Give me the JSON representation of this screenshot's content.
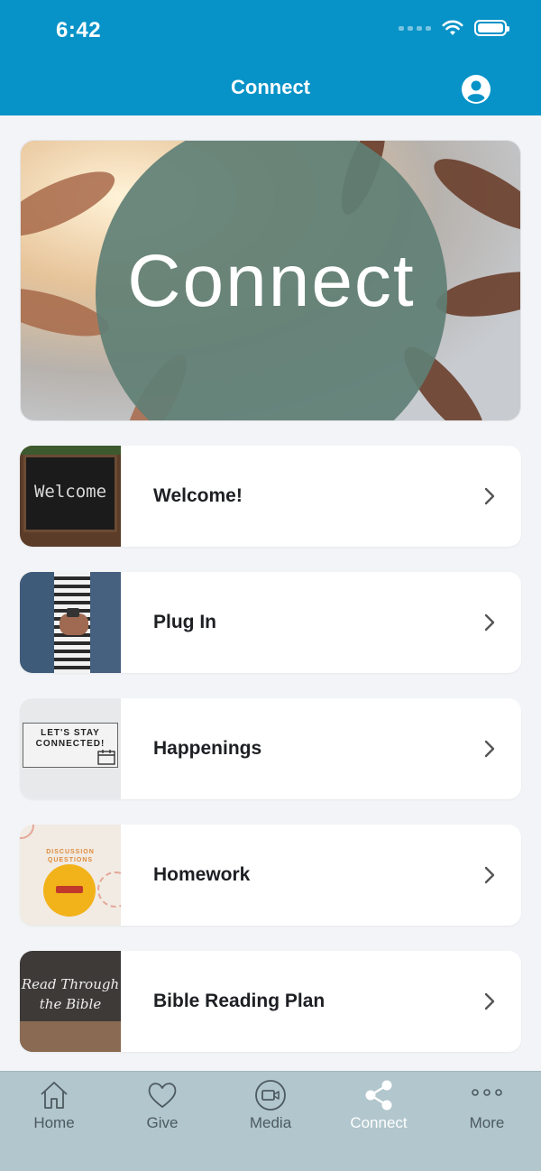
{
  "status_bar": {
    "time": "6:42"
  },
  "header": {
    "title": "Connect"
  },
  "hero": {
    "title": "Connect"
  },
  "items": [
    {
      "label": "Welcome!",
      "thumb_text": "Welcome"
    },
    {
      "label": "Plug In"
    },
    {
      "label": "Happenings",
      "thumb_line1": "LET'S STAY",
      "thumb_line2": "CONNECTED!"
    },
    {
      "label": "Homework",
      "thumb_line1": "DISCUSSION",
      "thumb_line2": "QUESTIONS"
    },
    {
      "label": "Bible Reading Plan",
      "thumb_line1": "Read Through",
      "thumb_line2": "the Bible"
    }
  ],
  "tabs": [
    {
      "label": "Home",
      "icon": "home-icon"
    },
    {
      "label": "Give",
      "icon": "heart-icon"
    },
    {
      "label": "Media",
      "icon": "video-icon"
    },
    {
      "label": "Connect",
      "icon": "share-icon",
      "active": true
    },
    {
      "label": "More",
      "icon": "more-icon"
    }
  ],
  "colors": {
    "header": "#0893c8",
    "tabbar": "#b1c6cd",
    "hero_circle": "#5f7f75"
  }
}
